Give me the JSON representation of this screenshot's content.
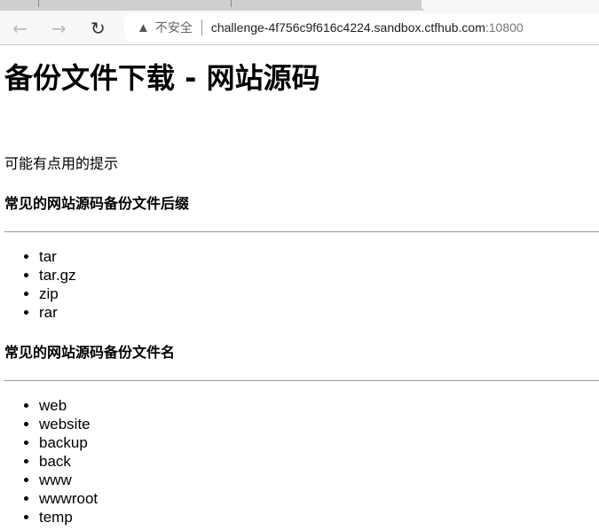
{
  "browser": {
    "security_label": "不安全",
    "url_host": "challenge-4f756c9f616c4224.sandbox.ctfhub.com",
    "url_port": ":10800"
  },
  "page": {
    "title": "备份文件下载 - 网站源码",
    "hint": "可能有点用的提示",
    "suffix_heading": "常见的网站源码备份文件后缀",
    "suffixes": [
      "tar",
      "tar.gz",
      "zip",
      "rar"
    ],
    "name_heading": "常见的网站源码备份文件名",
    "names": [
      "web",
      "website",
      "backup",
      "back",
      "www",
      "wwwroot",
      "temp"
    ]
  }
}
